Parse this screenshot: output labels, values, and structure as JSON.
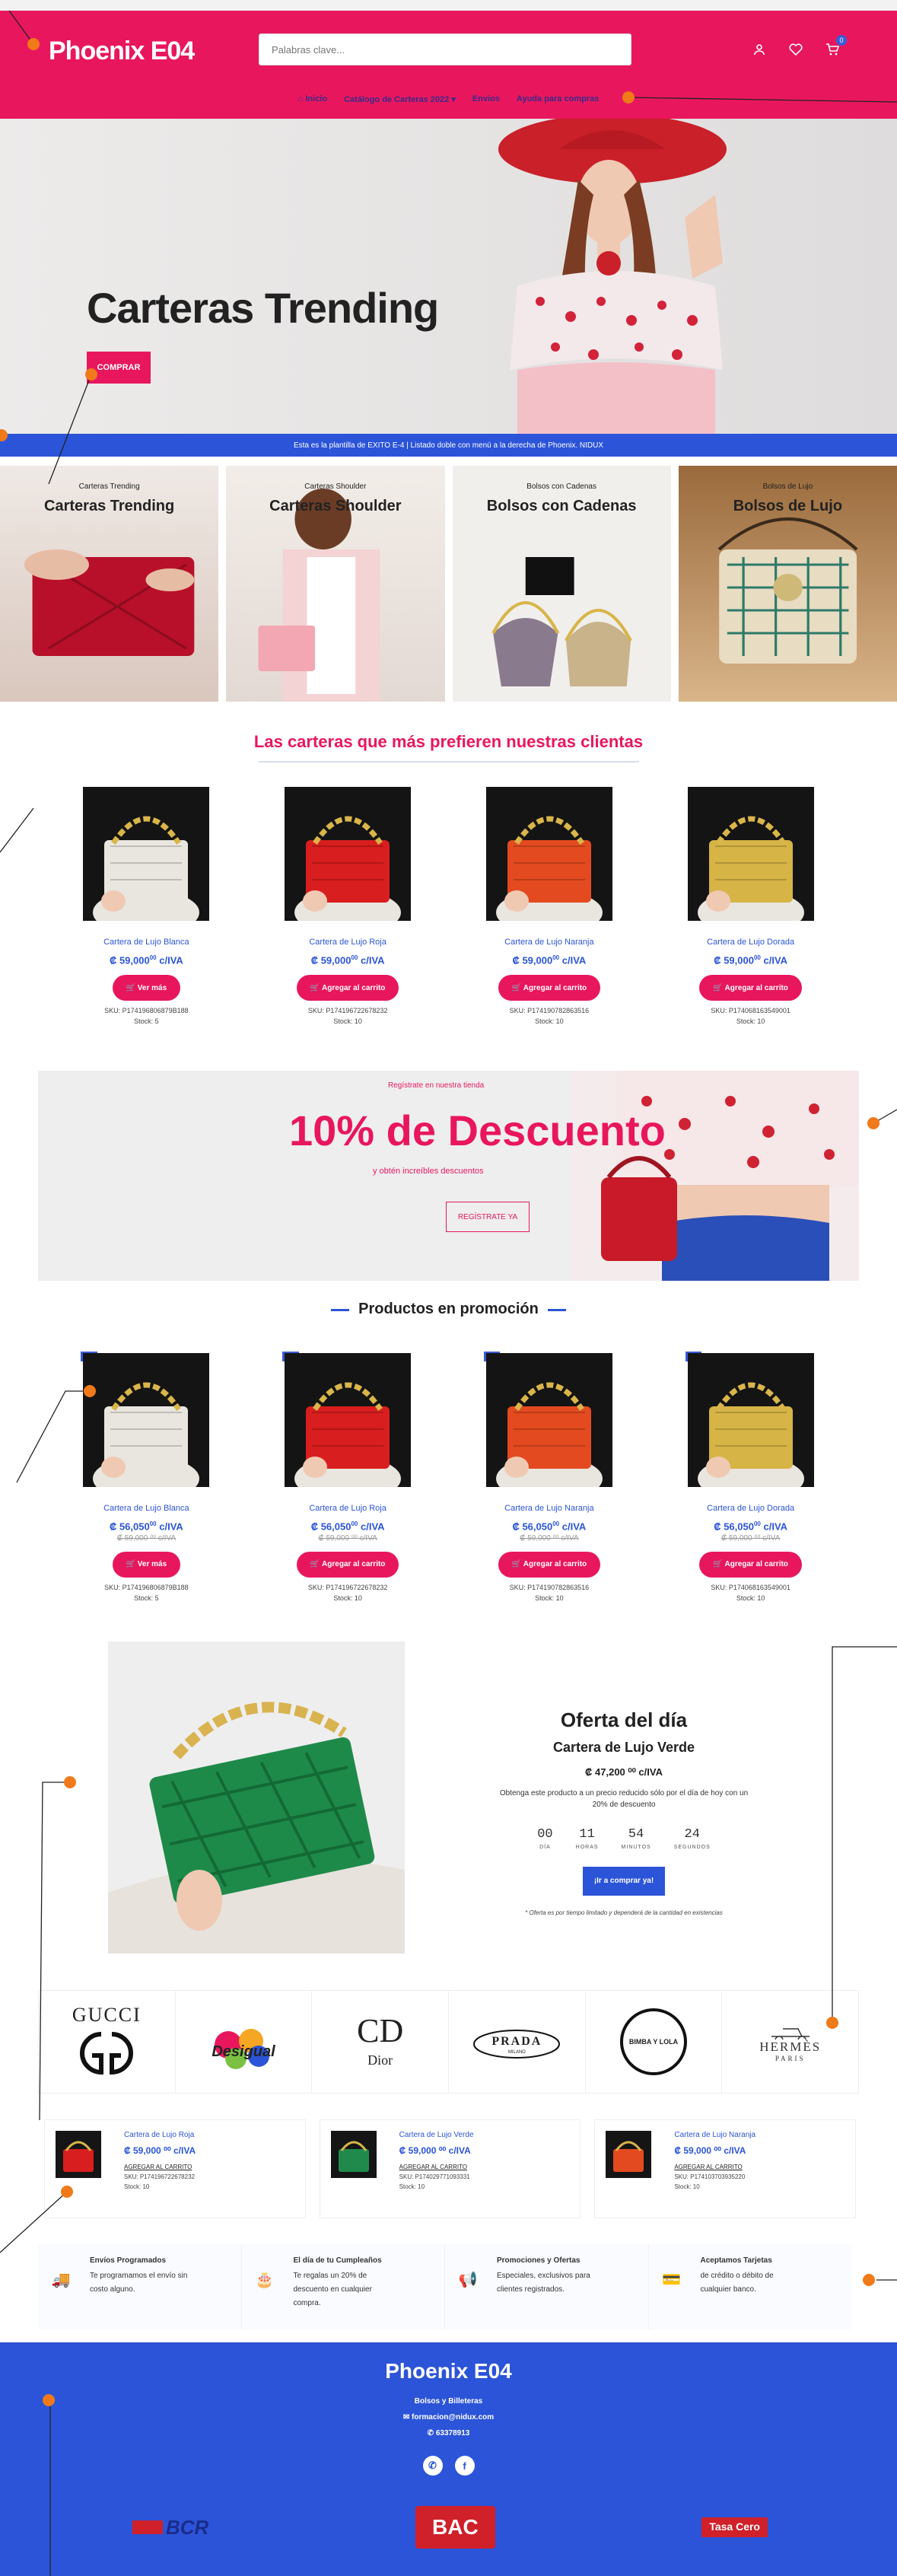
{
  "header": {
    "logo": "Phoenix E04",
    "search_placeholder": "Palabras clave...",
    "cart_count": "0",
    "nav": [
      "Inicio",
      "Catálogo de Carteras 2022 ▾",
      "Envíos",
      "Ayuda para compras"
    ]
  },
  "hero": {
    "title": "Carteras Trending",
    "button": "COMPRAR"
  },
  "infobar": "Esta es la plantilla de EXITO E-4 | Listado doble con menú a la derecha de Phoenix. NIDUX",
  "categories": [
    {
      "small": "Carteras Trending",
      "big": "Carteras Trending"
    },
    {
      "small": "Carteras Shoulder",
      "big": "Carteras Shoulder"
    },
    {
      "small": "Bolsos con Cadenas",
      "big": "Bolsos con Cadenas"
    },
    {
      "small": "Bolsos de Lujo",
      "big": "Bolsos de Lujo"
    }
  ],
  "featured": {
    "title": "Las carteras que más prefieren nuestras clientas",
    "products": [
      {
        "name": "Cartera de Lujo Blanca",
        "price": "₡ 59,000",
        "cents": "00",
        "tax": "c/IVA",
        "button": "Ver más",
        "sku": "SKU: P174196806879B188",
        "stock": "Stock: 5",
        "color": "#e9e6e0"
      },
      {
        "name": "Cartera de Lujo Roja",
        "price": "₡ 59,000",
        "cents": "00",
        "tax": "c/IVA",
        "button": "Agregar al carrito",
        "sku": "SKU: P174196722678232",
        "stock": "Stock: 10",
        "color": "#d81e1e"
      },
      {
        "name": "Cartera de Lujo Naranja",
        "price": "₡ 59,000",
        "cents": "00",
        "tax": "c/IVA",
        "button": "Agregar al carrito",
        "sku": "SKU: P174190782863516",
        "stock": "Stock: 10",
        "color": "#e34a1f"
      },
      {
        "name": "Cartera de Lujo Dorada",
        "price": "₡ 59,000",
        "cents": "00",
        "tax": "c/IVA",
        "button": "Agregar al carrito",
        "sku": "SKU: P174068163549001",
        "stock": "Stock: 10",
        "color": "#d6b446"
      }
    ]
  },
  "promo": {
    "sub": "Regístrate en nuestra tienda",
    "big": "10% de Descuento",
    "text": "y obtén increíbles descuentos",
    "button": "REGÍSTRATE YA"
  },
  "promo_products": {
    "title": "Productos en promoción",
    "products": [
      {
        "badge": "5%",
        "name": "Cartera de Lujo Blanca",
        "price": "₡ 56,050",
        "cents": "00",
        "tax": "c/IVA",
        "old": "₡ 59,000 ⁰⁰ c/IVA",
        "button": "Ver más",
        "sku": "SKU: P174196806879B188",
        "stock": "Stock: 5",
        "color": "#e9e6e0"
      },
      {
        "badge": "5%",
        "name": "Cartera de Lujo Roja",
        "price": "₡ 56,050",
        "cents": "00",
        "tax": "c/IVA",
        "old": "₡ 59,000 ⁰⁰ c/IVA",
        "button": "Agregar al carrito",
        "sku": "SKU: P174196722678232",
        "stock": "Stock: 10",
        "color": "#d81e1e"
      },
      {
        "badge": "5%",
        "name": "Cartera de Lujo Naranja",
        "price": "₡ 56,050",
        "cents": "00",
        "tax": "c/IVA",
        "old": "₡ 59,000 ⁰⁰ c/IVA",
        "button": "Agregar al carrito",
        "sku": "SKU: P174190782863516",
        "stock": "Stock: 10",
        "color": "#e34a1f"
      },
      {
        "badge": "5%",
        "name": "Cartera de Lujo Dorada",
        "price": "₡ 56,050",
        "cents": "00",
        "tax": "c/IVA",
        "old": "₡ 59,000 ⁰⁰ c/IVA",
        "button": "Agregar al carrito",
        "sku": "SKU: P174068163549001",
        "stock": "Stock: 10",
        "color": "#d6b446"
      }
    ]
  },
  "deal": {
    "heading": "Oferta del día",
    "name": "Cartera de Lujo Verde",
    "price": "₡ 47,200 ⁰⁰ c/IVA",
    "desc": "Obtenga este producto a un precio reducido sólo por el día de hoy con un 20% de descuento",
    "countdown": [
      {
        "n": "00",
        "l": "DÍA"
      },
      {
        "n": "11",
        "l": "HORAS"
      },
      {
        "n": "54",
        "l": "MINUTOS"
      },
      {
        "n": "24",
        "l": "SEGUNDOS"
      }
    ],
    "button": "¡Ir a comprar ya!",
    "note": "* Oferta es por tiempo limitado y dependerá de la cantidad en existencias"
  },
  "brands": [
    "GUCCI",
    "Desigual",
    "Dior",
    "PRADA",
    "BIMBA Y LOLA",
    "HERMÈS"
  ],
  "brand_sub": {
    "hermes": "PARIS",
    "prada": "MILANO"
  },
  "mini_items": [
    {
      "name": "Cartera de Lujo Roja",
      "price": "₡ 59,000 ⁰⁰ c/IVA",
      "add": "AGREGAR AL CARRITO",
      "sku": "SKU: P174196722678232",
      "stock": "Stock: 10",
      "color": "#d81e1e"
    },
    {
      "name": "Cartera de Lujo Verde",
      "price": "₡ 59,000 ⁰⁰ c/IVA",
      "add": "AGREGAR AL CARRITO",
      "sku": "SKU: P174029771093331",
      "stock": "Stock: 10",
      "color": "#1f8a4c"
    },
    {
      "name": "Cartera de Lujo Naranja",
      "price": "₡ 59,000 ⁰⁰ c/IVA",
      "add": "AGREGAR AL CARRITO",
      "sku": "SKU: P174103703935220",
      "stock": "Stock: 10",
      "color": "#e34a1f"
    }
  ],
  "features": [
    {
      "title": "Envíos Programados",
      "lines": [
        "Te programamos el envío sin",
        "costo alguno."
      ],
      "icon": "truck-icon"
    },
    {
      "title": "El día de tu Cumpleaños",
      "lines": [
        "Te regalas un 20% de",
        "descuento en cualquier",
        "compra."
      ],
      "icon": "cake-icon"
    },
    {
      "title": "Promociones y Ofertas",
      "lines": [
        "Especiales, exclusivos para",
        "clientes registrados."
      ],
      "icon": "megaphone-icon"
    },
    {
      "title": "Aceptamos Tarjetas",
      "lines": [
        "de crédito o débito de",
        "cualquier banco."
      ],
      "icon": "card-icon"
    }
  ],
  "footer": {
    "logo": "Phoenix E04",
    "tagline": "Bolsos y Billeteras",
    "email": "formacion@nidux.com",
    "phone": "63378913",
    "banks": [
      "BCR",
      "BAC",
      "Tasa Cero"
    ]
  },
  "colors": {
    "brand": "#e8175d",
    "accent": "#2c54d8",
    "annotation": "#f07a1a"
  }
}
